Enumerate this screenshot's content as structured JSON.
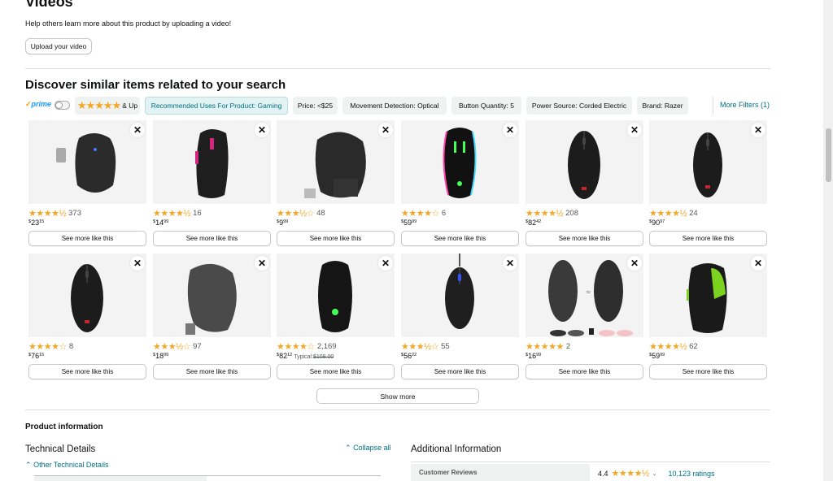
{
  "videos": {
    "title": "Videos",
    "help_text": "Help others learn more about this product by uploading a video!",
    "upload_label": "Upload your video"
  },
  "discover": {
    "title": "Discover similar items related to your search",
    "prime_label": "prime",
    "stars_chip": {
      "stars": "★★★★★",
      "label": "& Up"
    },
    "chips": [
      "Recommended Uses For Product: Gaming",
      "Price: <$25",
      "Movement Detection: Optical",
      "Button Quantity: 5",
      "Power Source: Corded Electric",
      "Brand: Razer"
    ],
    "more_filters": "More Filters (1)",
    "see_more_label": "See more like this",
    "close_glyph": "✕",
    "show_more_label": "Show more",
    "products": [
      {
        "stars": "★★★★½",
        "rating": 4.5,
        "reviews": "373",
        "price_whole": "23",
        "price_fraction": "15",
        "image_kind": "mouse-dongle"
      },
      {
        "stars": "★★★★½",
        "rating": 4.5,
        "reviews": "16",
        "price_whole": "14",
        "price_fraction": "99",
        "image_kind": "gaming-mouse-magenta"
      },
      {
        "stars": "★★★½☆",
        "rating": 3.5,
        "reviews": "48",
        "price_whole": "9",
        "price_fraction": "99",
        "image_kind": "ergonomic-mouse-box"
      },
      {
        "stars": "★★★★☆",
        "rating": 4.0,
        "reviews": "6",
        "price_whole": "59",
        "price_fraction": "99",
        "image_kind": "rgb-razer-mouse"
      },
      {
        "stars": "★★★★½",
        "rating": 4.5,
        "reviews": "208",
        "price_whole": "82",
        "price_fraction": "42",
        "image_kind": "zowie-mouse"
      },
      {
        "stars": "★★★★½",
        "rating": 4.5,
        "reviews": "24",
        "price_whole": "90",
        "price_fraction": "97",
        "image_kind": "zowie-mouse-slim"
      },
      {
        "stars": "★★★★☆",
        "rating": 4.0,
        "reviews": "8",
        "price_whole": "76",
        "price_fraction": "15",
        "image_kind": "zowie-mouse"
      },
      {
        "stars": "★★★½☆",
        "rating": 3.5,
        "reviews": "97",
        "price_whole": "18",
        "price_fraction": "99",
        "image_kind": "ergonomic-mouse-gray"
      },
      {
        "stars": "★★★★☆",
        "rating": 4.0,
        "reviews": "2,169",
        "price_whole": "82",
        "price_fraction": "12",
        "typical_label": "Typical:",
        "typical_price": "$109.00",
        "image_kind": "razer-viper"
      },
      {
        "stars": "★★★½☆",
        "rating": 3.5,
        "reviews": "55",
        "price_whole": "56",
        "price_fraction": "22",
        "image_kind": "slim-blue-mouse"
      },
      {
        "stars": "★★★★★",
        "rating": 5.0,
        "reviews": "2",
        "price_whole": "16",
        "price_fraction": "99",
        "image_kind": "wireless-pair"
      },
      {
        "stars": "★★★★½",
        "rating": 4.5,
        "reviews": "62",
        "price_whole": "59",
        "price_fraction": "99",
        "image_kind": "green-accent-mouse"
      }
    ]
  },
  "product_info": {
    "title": "Product information",
    "technical_details": "Technical Details",
    "collapse_all": "Collapse all",
    "other_technical": "Other Technical Details",
    "additional_information": "Additional Information",
    "customer_reviews_label": "Customer Reviews",
    "customer_reviews_rating": "4.4",
    "customer_reviews_stars": "★★★★½",
    "customer_reviews_count": "10,123 ratings"
  },
  "colors": {
    "link": "#007185",
    "star": "#f5a623",
    "prime_blue": "#1399ff",
    "chip_bg": "#f0f2f2",
    "active_chip_bg": "#e3f2f3"
  }
}
